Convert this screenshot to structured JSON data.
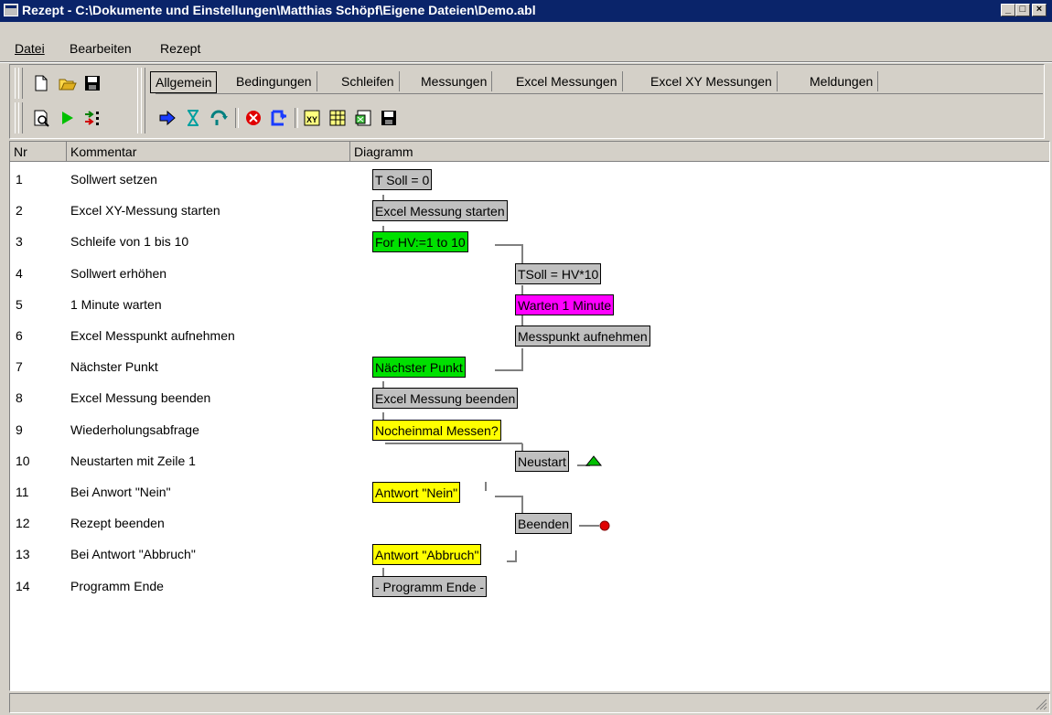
{
  "window": {
    "title": "Rezept - C:\\Dokumente und Einstellungen\\Matthias Schöpf\\Eigene Dateien\\Demo.abl"
  },
  "menu": {
    "datei": "Datei",
    "bearbeiten": "Bearbeiten",
    "rezept": "Rezept"
  },
  "tabs": [
    "Allgemein",
    "Bedingungen",
    "Schleifen",
    "Messungen",
    "Excel Messungen",
    "Excel XY Messungen",
    "Meldungen"
  ],
  "columns": {
    "nr": "Nr",
    "kommentar": "Kommentar",
    "diagramm": "Diagramm"
  },
  "rows": [
    {
      "nr": "1",
      "comment": "Sollwert setzen",
      "node": "T Soll = 0",
      "color": "gray"
    },
    {
      "nr": "2",
      "comment": "Excel XY-Messung starten",
      "node": "Excel Messung starten",
      "color": "gray"
    },
    {
      "nr": "3",
      "comment": "Schleife von 1 bis 10",
      "node": "For HV:=1 to 10",
      "color": "green"
    },
    {
      "nr": "4",
      "comment": "Sollwert erhöhen",
      "node": "TSoll = HV*10",
      "color": "gray"
    },
    {
      "nr": "5",
      "comment": "1 Minute warten",
      "node": "Warten 1 Minute",
      "color": "magenta"
    },
    {
      "nr": "6",
      "comment": "Excel Messpunkt aufnehmen",
      "node": "Messpunkt aufnehmen",
      "color": "gray"
    },
    {
      "nr": "7",
      "comment": "Nächster Punkt",
      "node": "Nächster Punkt",
      "color": "green"
    },
    {
      "nr": "8",
      "comment": "Excel Messung beenden",
      "node": "Excel Messung beenden",
      "color": "gray"
    },
    {
      "nr": "9",
      "comment": "Wiederholungsabfrage",
      "node": "Nocheinmal Messen?",
      "color": "yellow"
    },
    {
      "nr": "10",
      "comment": "Neustarten mit Zeile 1",
      "node": "Neustart",
      "color": "gray"
    },
    {
      "nr": "11",
      "comment": "Bei Anwort \"Nein\"",
      "node": "Antwort \"Nein\"",
      "color": "yellow"
    },
    {
      "nr": "12",
      "comment": "Rezept beenden",
      "node": "Beenden",
      "color": "gray"
    },
    {
      "nr": "13",
      "comment": "Bei Antwort \"Abbruch\"",
      "node": "Antwort \"Abbruch\"",
      "color": "yellow"
    },
    {
      "nr": "14",
      "comment": "Programm Ende",
      "node": "- Programm Ende -",
      "color": "gray"
    }
  ],
  "colors": {
    "gray": "#c0c0c0",
    "green": "#00e000",
    "magenta": "#ff00ff",
    "yellow": "#ffff00",
    "title": "#0a246a"
  },
  "toolbar_icons": [
    "new-file-icon",
    "open-folder-icon",
    "save-disk-icon",
    "print-preview-icon",
    "run-play-icon",
    "step-icon",
    "arrow-right-icon",
    "hourglass-icon",
    "loop-icon",
    "stop-icon",
    "jump-icon",
    "excel-xy-icon",
    "excel-table-icon",
    "excel-export-icon",
    "save-disk-icon"
  ]
}
